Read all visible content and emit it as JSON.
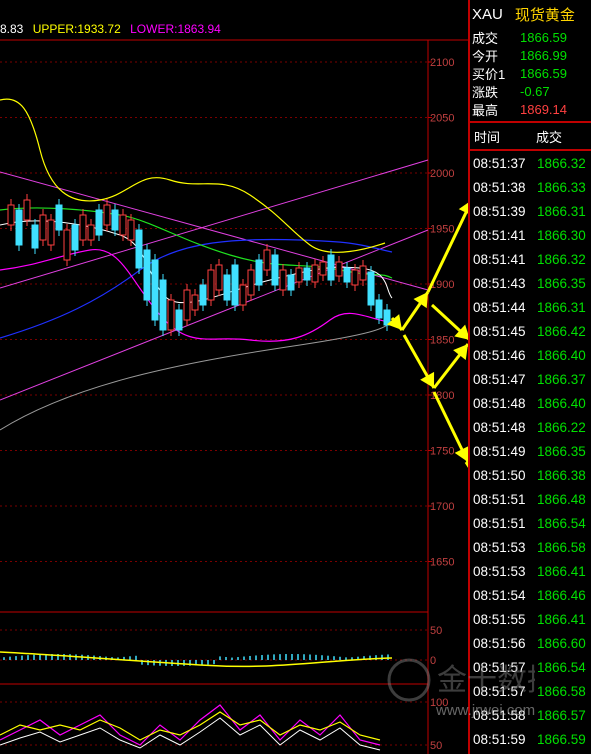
{
  "indicator_bar": {
    "mid": "8.83",
    "upper": "UPPER:1933.72",
    "lower": "LOWER:1863.94"
  },
  "price_axis": {
    "ticks": [
      "2100",
      "2050",
      "2000",
      "1950",
      "1900",
      "1850",
      "1800",
      "1750",
      "1700",
      "1650"
    ],
    "osc1_ticks": [
      "50",
      "0"
    ],
    "osc2_ticks": [
      "100",
      "50"
    ]
  },
  "quote": {
    "symbol": "XAU",
    "name": "现货黄金",
    "rows": [
      {
        "label": "成交",
        "value": "1866.59",
        "color": "green"
      },
      {
        "label": "今开",
        "value": "1866.99",
        "color": "green"
      },
      {
        "label": "买价1",
        "value": "1866.59",
        "color": "green"
      },
      {
        "label": "涨跌",
        "value": "-0.67",
        "color": "green"
      },
      {
        "label": "最高",
        "value": "1869.14",
        "color": "red"
      }
    ]
  },
  "trades": {
    "col_time": "时间",
    "col_price": "成交",
    "rows": [
      {
        "time": "08:51:37",
        "price": "1866.32"
      },
      {
        "time": "08:51:38",
        "price": "1866.33"
      },
      {
        "time": "08:51:39",
        "price": "1866.31"
      },
      {
        "time": "08:51:41",
        "price": "1866.30"
      },
      {
        "time": "08:51:41",
        "price": "1866.32"
      },
      {
        "time": "08:51:43",
        "price": "1866.35"
      },
      {
        "time": "08:51:44",
        "price": "1866.31"
      },
      {
        "time": "08:51:45",
        "price": "1866.42"
      },
      {
        "time": "08:51:46",
        "price": "1866.40"
      },
      {
        "time": "08:51:47",
        "price": "1866.37"
      },
      {
        "time": "08:51:48",
        "price": "1866.40"
      },
      {
        "time": "08:51:48",
        "price": "1866.22"
      },
      {
        "time": "08:51:49",
        "price": "1866.35"
      },
      {
        "time": "08:51:50",
        "price": "1866.38"
      },
      {
        "time": "08:51:51",
        "price": "1866.48"
      },
      {
        "time": "08:51:51",
        "price": "1866.54"
      },
      {
        "time": "08:51:53",
        "price": "1866.58"
      },
      {
        "time": "08:51:53",
        "price": "1866.41"
      },
      {
        "time": "08:51:54",
        "price": "1866.46"
      },
      {
        "time": "08:51:55",
        "price": "1866.41"
      },
      {
        "time": "08:51:56",
        "price": "1866.60"
      },
      {
        "time": "08:51:57",
        "price": "1866.54"
      },
      {
        "time": "08:51:57",
        "price": "1866.58"
      },
      {
        "time": "08:51:58",
        "price": "1866.57"
      },
      {
        "time": "08:51:59",
        "price": "1866.59"
      }
    ]
  },
  "watermark": {
    "brand": "金十数据",
    "url": "www.jrwei.com"
  },
  "colors": {
    "up": "#00e000",
    "down": "#ff4040",
    "axis": "#c00000",
    "upper_band": "#ffff00",
    "lower_band": "#ff00ff",
    "arrow": "#ffff00"
  }
}
